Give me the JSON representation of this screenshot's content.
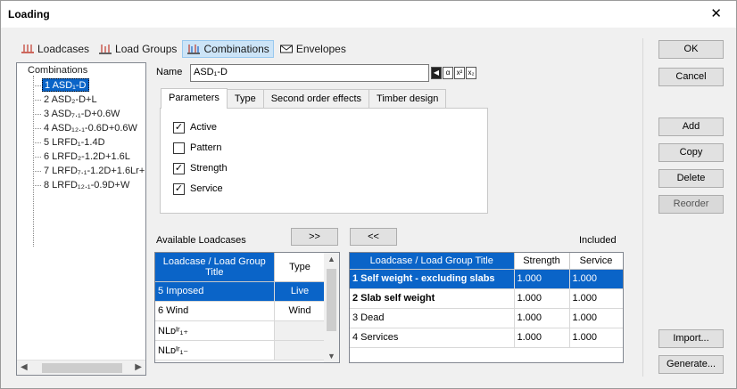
{
  "window": {
    "title": "Loading",
    "close_glyph": "✕"
  },
  "top_tabs": [
    {
      "label": "Loadcases",
      "icon": "loadcases-icon"
    },
    {
      "label": "Load Groups",
      "icon": "load-groups-icon"
    },
    {
      "label": "Combinations",
      "icon": "combinations-icon",
      "active": true
    },
    {
      "label": "Envelopes",
      "icon": "envelopes-icon"
    }
  ],
  "tree": {
    "root": "Combinations",
    "items": [
      "1 ASD₁-D",
      "2 ASD₂-D+L",
      "3 ASD₇.₁-D+0.6W",
      "4 ASD₁₂.₁-0.6D+0.6W",
      "5 LRFD₁-1.4D",
      "6 LRFD₂-1.2D+1.6L",
      "7 LRFD₇.₁-1.2D+1.6Lr+",
      "8 LRFD₁₂.₁-0.9D+W"
    ],
    "selected_index": 0
  },
  "name": {
    "label": "Name",
    "value": "ASD₁-D",
    "format_buttons": [
      "◀",
      "α",
      "x²",
      "x₂"
    ]
  },
  "sub_tabs": [
    "Parameters",
    "Type",
    "Second order effects",
    "Timber design"
  ],
  "parameters": [
    {
      "label": "Active",
      "checked": true
    },
    {
      "label": "Pattern",
      "checked": false
    },
    {
      "label": "Strength",
      "checked": true
    },
    {
      "label": "Service",
      "checked": true
    }
  ],
  "available": {
    "label": "Available Loadcases",
    "col_title": "Loadcase / Load Group Title",
    "col_type": "Type",
    "rows": [
      {
        "title": "5 Imposed",
        "type": "Live"
      },
      {
        "title": "6 Wind",
        "type": "Wind"
      },
      {
        "title": "NLᴅᴵʳ₁₊",
        "type": ""
      },
      {
        "title": "NLᴅᴵʳ₁₋",
        "type": ""
      }
    ]
  },
  "transfer": {
    "add_all": ">>",
    "remove_all": "<<"
  },
  "included": {
    "label": "Included",
    "col_title": "Loadcase / Load Group Title",
    "col_strength": "Strength",
    "col_service": "Service",
    "rows": [
      {
        "title": "1 Self weight - excluding slabs",
        "strength": "1.000",
        "service": "1.000",
        "bold": true
      },
      {
        "title": "2 Slab self weight",
        "strength": "1.000",
        "service": "1.000",
        "bold": true
      },
      {
        "title": "3 Dead",
        "strength": "1.000",
        "service": "1.000",
        "bold": false
      },
      {
        "title": "4 Services",
        "strength": "1.000",
        "service": "1.000",
        "bold": false
      }
    ]
  },
  "buttons": {
    "ok": "OK",
    "cancel": "Cancel",
    "add": "Add",
    "copy": "Copy",
    "delete": "Delete",
    "reorder": "Reorder",
    "import": "Import...",
    "generate": "Generate..."
  },
  "colors": {
    "selection": "#0a64c8",
    "tab_active": "#cce4f7",
    "icon_red": "#c0392b"
  }
}
